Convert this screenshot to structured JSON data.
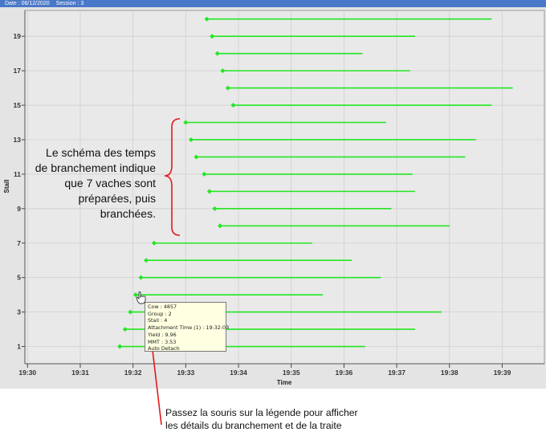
{
  "header": {
    "date_text": "Date : 06/12/2020",
    "session_text": "Session : 3"
  },
  "chart_data": {
    "type": "timeline",
    "xlabel": "Time",
    "ylabel": "Stall",
    "x_ticks": [
      "19:30",
      "19:31",
      "19:32",
      "19:33",
      "19:34",
      "19:35",
      "19:36",
      "19:37",
      "19:38",
      "19:39"
    ],
    "y_ticks": [
      "1",
      "3",
      "5",
      "7",
      "9",
      "11",
      "13",
      "15",
      "17",
      "19"
    ],
    "xlim": [
      "19:29.95",
      "19:39.8"
    ],
    "ylim": [
      0,
      20.5
    ],
    "grid": true,
    "series_color": "#22e622",
    "bars": [
      {
        "stall": 1,
        "start": "19:31.75",
        "end": "19:36.40"
      },
      {
        "stall": 2,
        "start": "19:31.85",
        "end": "19:37.35"
      },
      {
        "stall": 3,
        "start": "19:31.95",
        "end": "19:37.85"
      },
      {
        "stall": 4,
        "start": "19:32.05",
        "end": "19:35.60"
      },
      {
        "stall": 5,
        "start": "19:32.15",
        "end": "19:36.70"
      },
      {
        "stall": 6,
        "start": "19:32.25",
        "end": "19:36.15"
      },
      {
        "stall": 7,
        "start": "19:32.40",
        "end": "19:35.40"
      },
      {
        "stall": 8,
        "start": "19:33.65",
        "end": "19:38.00"
      },
      {
        "stall": 9,
        "start": "19:33.55",
        "end": "19:36.90"
      },
      {
        "stall": 10,
        "start": "19:33.45",
        "end": "19:37.35"
      },
      {
        "stall": 11,
        "start": "19:33.35",
        "end": "19:37.30"
      },
      {
        "stall": 12,
        "start": "19:33.20",
        "end": "19:38.30"
      },
      {
        "stall": 13,
        "start": "19:33.10",
        "end": "19:38.50"
      },
      {
        "stall": 14,
        "start": "19:33.00",
        "end": "19:36.80"
      },
      {
        "stall": 15,
        "start": "19:33.90",
        "end": "19:38.80"
      },
      {
        "stall": 16,
        "start": "19:33.80",
        "end": "19:39.20"
      },
      {
        "stall": 17,
        "start": "19:33.70",
        "end": "19:37.25"
      },
      {
        "stall": 18,
        "start": "19:33.60",
        "end": "19:36.35"
      },
      {
        "stall": 19,
        "start": "19:33.50",
        "end": "19:37.35"
      },
      {
        "stall": 20,
        "start": "19:33.40",
        "end": "19:38.80"
      }
    ]
  },
  "tooltip": {
    "lines": [
      "Cow : 4857",
      "Group : 2",
      "Stall : 4",
      "Attachment Time (1) : 19:32:03",
      "Yield : 9.96",
      "MMT : 3.53",
      "Auto Detach"
    ]
  },
  "annotation": {
    "lines": [
      "Le schéma des temps",
      "de branchement indique",
      "que 7 vaches sont",
      "préparées, puis",
      "branchées."
    ]
  },
  "callout": {
    "lines": [
      "Passez la souris sur la légende pour afficher",
      "les détails du branchement et de la traite"
    ]
  }
}
